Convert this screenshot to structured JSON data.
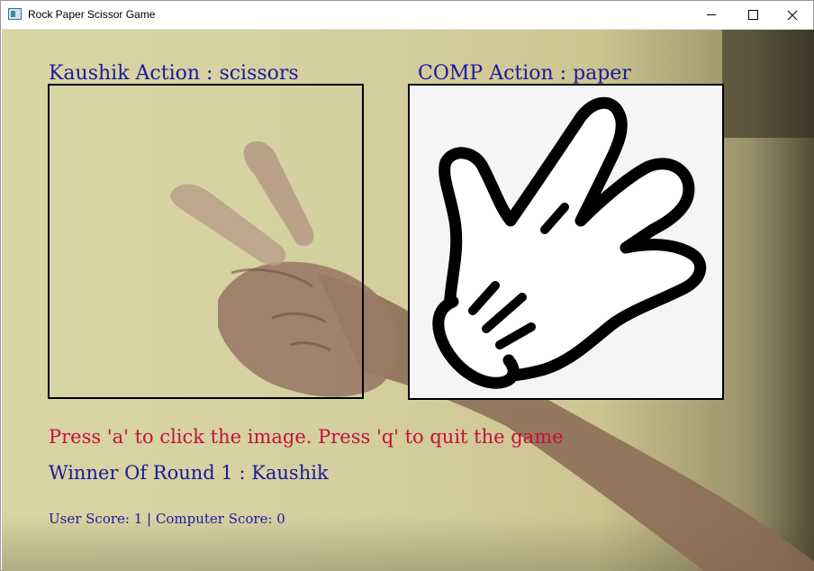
{
  "window": {
    "title": "Rock Paper Scissor Game",
    "icon": "app-window-icon",
    "controls": [
      "minimize-icon",
      "maximize-icon",
      "close-icon"
    ]
  },
  "game": {
    "user_action_label": "Kaushik Action : scissors",
    "comp_action_label": "COMP Action : paper",
    "comp_image": "paper-hand-icon",
    "instruction": "Press 'a' to click the image. Press 'q' to quit the game",
    "winner": "Winner Of Round 1 : Kaushik",
    "score": "User Score: 1 | Computer Score: 0"
  },
  "colors": {
    "label_blue": "#1a1a9c",
    "instruction_red": "#c4103a",
    "frame": "#000000"
  }
}
